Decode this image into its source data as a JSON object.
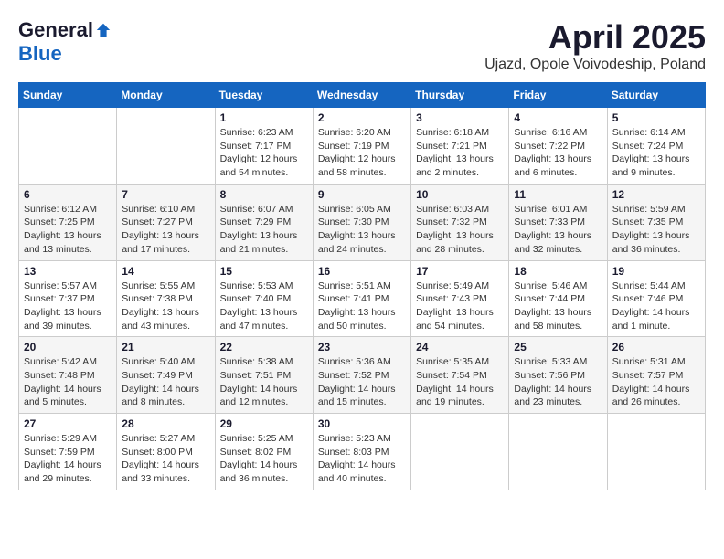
{
  "header": {
    "logo_general": "General",
    "logo_blue": "Blue",
    "month_title": "April 2025",
    "subtitle": "Ujazd, Opole Voivodeship, Poland"
  },
  "days_of_week": [
    "Sunday",
    "Monday",
    "Tuesday",
    "Wednesday",
    "Thursday",
    "Friday",
    "Saturday"
  ],
  "weeks": [
    [
      {
        "day": "",
        "info": ""
      },
      {
        "day": "",
        "info": ""
      },
      {
        "day": "1",
        "info": "Sunrise: 6:23 AM\nSunset: 7:17 PM\nDaylight: 12 hours\nand 54 minutes."
      },
      {
        "day": "2",
        "info": "Sunrise: 6:20 AM\nSunset: 7:19 PM\nDaylight: 12 hours\nand 58 minutes."
      },
      {
        "day": "3",
        "info": "Sunrise: 6:18 AM\nSunset: 7:21 PM\nDaylight: 13 hours\nand 2 minutes."
      },
      {
        "day": "4",
        "info": "Sunrise: 6:16 AM\nSunset: 7:22 PM\nDaylight: 13 hours\nand 6 minutes."
      },
      {
        "day": "5",
        "info": "Sunrise: 6:14 AM\nSunset: 7:24 PM\nDaylight: 13 hours\nand 9 minutes."
      }
    ],
    [
      {
        "day": "6",
        "info": "Sunrise: 6:12 AM\nSunset: 7:25 PM\nDaylight: 13 hours\nand 13 minutes."
      },
      {
        "day": "7",
        "info": "Sunrise: 6:10 AM\nSunset: 7:27 PM\nDaylight: 13 hours\nand 17 minutes."
      },
      {
        "day": "8",
        "info": "Sunrise: 6:07 AM\nSunset: 7:29 PM\nDaylight: 13 hours\nand 21 minutes."
      },
      {
        "day": "9",
        "info": "Sunrise: 6:05 AM\nSunset: 7:30 PM\nDaylight: 13 hours\nand 24 minutes."
      },
      {
        "day": "10",
        "info": "Sunrise: 6:03 AM\nSunset: 7:32 PM\nDaylight: 13 hours\nand 28 minutes."
      },
      {
        "day": "11",
        "info": "Sunrise: 6:01 AM\nSunset: 7:33 PM\nDaylight: 13 hours\nand 32 minutes."
      },
      {
        "day": "12",
        "info": "Sunrise: 5:59 AM\nSunset: 7:35 PM\nDaylight: 13 hours\nand 36 minutes."
      }
    ],
    [
      {
        "day": "13",
        "info": "Sunrise: 5:57 AM\nSunset: 7:37 PM\nDaylight: 13 hours\nand 39 minutes."
      },
      {
        "day": "14",
        "info": "Sunrise: 5:55 AM\nSunset: 7:38 PM\nDaylight: 13 hours\nand 43 minutes."
      },
      {
        "day": "15",
        "info": "Sunrise: 5:53 AM\nSunset: 7:40 PM\nDaylight: 13 hours\nand 47 minutes."
      },
      {
        "day": "16",
        "info": "Sunrise: 5:51 AM\nSunset: 7:41 PM\nDaylight: 13 hours\nand 50 minutes."
      },
      {
        "day": "17",
        "info": "Sunrise: 5:49 AM\nSunset: 7:43 PM\nDaylight: 13 hours\nand 54 minutes."
      },
      {
        "day": "18",
        "info": "Sunrise: 5:46 AM\nSunset: 7:44 PM\nDaylight: 13 hours\nand 58 minutes."
      },
      {
        "day": "19",
        "info": "Sunrise: 5:44 AM\nSunset: 7:46 PM\nDaylight: 14 hours\nand 1 minute."
      }
    ],
    [
      {
        "day": "20",
        "info": "Sunrise: 5:42 AM\nSunset: 7:48 PM\nDaylight: 14 hours\nand 5 minutes."
      },
      {
        "day": "21",
        "info": "Sunrise: 5:40 AM\nSunset: 7:49 PM\nDaylight: 14 hours\nand 8 minutes."
      },
      {
        "day": "22",
        "info": "Sunrise: 5:38 AM\nSunset: 7:51 PM\nDaylight: 14 hours\nand 12 minutes."
      },
      {
        "day": "23",
        "info": "Sunrise: 5:36 AM\nSunset: 7:52 PM\nDaylight: 14 hours\nand 15 minutes."
      },
      {
        "day": "24",
        "info": "Sunrise: 5:35 AM\nSunset: 7:54 PM\nDaylight: 14 hours\nand 19 minutes."
      },
      {
        "day": "25",
        "info": "Sunrise: 5:33 AM\nSunset: 7:56 PM\nDaylight: 14 hours\nand 23 minutes."
      },
      {
        "day": "26",
        "info": "Sunrise: 5:31 AM\nSunset: 7:57 PM\nDaylight: 14 hours\nand 26 minutes."
      }
    ],
    [
      {
        "day": "27",
        "info": "Sunrise: 5:29 AM\nSunset: 7:59 PM\nDaylight: 14 hours\nand 29 minutes."
      },
      {
        "day": "28",
        "info": "Sunrise: 5:27 AM\nSunset: 8:00 PM\nDaylight: 14 hours\nand 33 minutes."
      },
      {
        "day": "29",
        "info": "Sunrise: 5:25 AM\nSunset: 8:02 PM\nDaylight: 14 hours\nand 36 minutes."
      },
      {
        "day": "30",
        "info": "Sunrise: 5:23 AM\nSunset: 8:03 PM\nDaylight: 14 hours\nand 40 minutes."
      },
      {
        "day": "",
        "info": ""
      },
      {
        "day": "",
        "info": ""
      },
      {
        "day": "",
        "info": ""
      }
    ]
  ]
}
